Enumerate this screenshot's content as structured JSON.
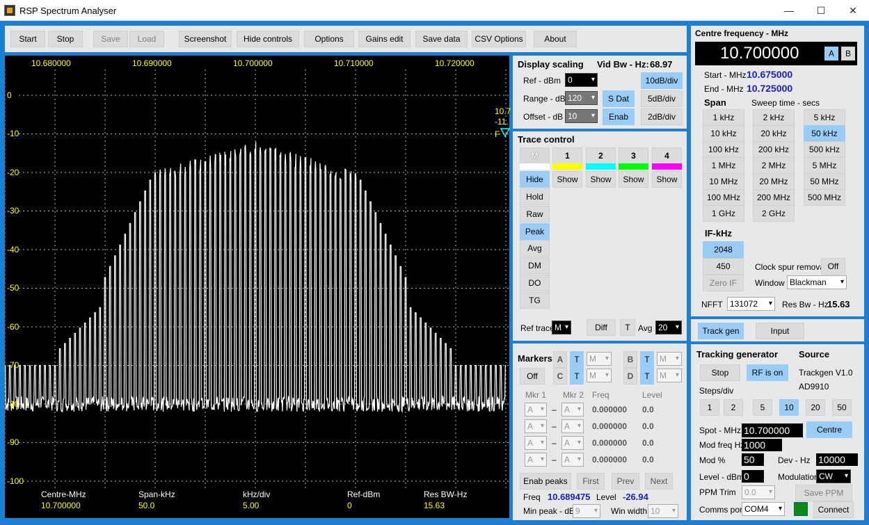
{
  "window": {
    "title": "RSP Spectrum Analyser",
    "min": "—",
    "max": "☐",
    "close": "✕"
  },
  "toolbar": {
    "start": "Start",
    "stop": "Stop",
    "save": "Save",
    "load": "Load",
    "screenshot": "Screenshot",
    "hide": "Hide controls",
    "options": "Options",
    "gains": "Gains edit",
    "savedata": "Save data",
    "csv": "CSV Options",
    "about": "About"
  },
  "plot": {
    "xticks": [
      "10.680000",
      "10.690000",
      "10.700000",
      "10.710000",
      "10.720000"
    ],
    "yticks": [
      "0",
      "-10",
      "-20",
      "-30",
      "-40",
      "-50",
      "-60",
      "-70",
      "-80",
      "-90",
      "-100"
    ],
    "marker_text1": "10.7",
    "marker_text2": "-11.",
    "marker_text3": "F",
    "footer": {
      "l1": "Centre-MHz",
      "v1": "10.700000",
      "l2": "Span-kHz",
      "v2": "50.0",
      "l3": "kHz/div",
      "v3": "5.00",
      "l4": "Ref-dBm",
      "v4": "0",
      "l5": "Res BW-Hz",
      "v5": "15.63"
    }
  },
  "chart_data": {
    "type": "line",
    "title": "",
    "xlabel": "",
    "ylabel": "",
    "xlim": [
      10.675,
      10.725
    ],
    "ylim": [
      -100,
      0
    ],
    "grid": true,
    "series": [
      {
        "values_note": "",
        "peaks_center": 10.7,
        "spacing": 0.0005
      }
    ]
  },
  "display": {
    "title": "Display scaling",
    "vidbw_label": "Vid Bw - Hz:",
    "vidbw": "68.97",
    "ref_label": "Ref - dBm",
    "ref": "0",
    "range_label": "Range - dB",
    "range": "120",
    "offset_label": "Offset - dB",
    "offset": "10",
    "b10": "10dB/div",
    "b5": "5dB/div",
    "b2": "2dB/div",
    "sdat": "S Dat",
    "enab": "Enab"
  },
  "trace": {
    "title": "Trace control",
    "tabs": [
      "M",
      "1",
      "2",
      "3",
      "4"
    ],
    "hide": "Hide",
    "show": "Show",
    "hold": "Hold",
    "raw": "Raw",
    "peak": "Peak",
    "avg": "Avg",
    "dm": "DM",
    "do": "DO",
    "tg": "TG",
    "reftrace_label": "Ref trace",
    "reftrace": "M",
    "diff": "Diff",
    "t": "T",
    "avg_label": "Avg",
    "avg_val": "20"
  },
  "markers": {
    "title": "Markers",
    "a": "A",
    "b": "B",
    "c": "C",
    "d": "D",
    "t": "T",
    "m": "M",
    "off": "Off",
    "mkr1": "Mkr 1",
    "mkr2": "Mkr 2",
    "freq_h": "Freq",
    "level_h": "Level",
    "freqs": [
      "0.000000",
      "0.000000",
      "0.000000",
      "0.000000"
    ],
    "levels": [
      "0.0",
      "0.0",
      "0.0",
      "0.0"
    ],
    "dash": "–",
    "enab_peaks": "Enab peaks",
    "first": "First",
    "prev": "Prev",
    "next": "Next",
    "freq_label": "Freq",
    "freq": "10.689475",
    "level_label": "Level",
    "level": "-26.94",
    "minpeak_label": "Min peak - dB",
    "minpeak": "9",
    "winwidth_label": "Win width",
    "winwidth": "10"
  },
  "centre": {
    "title": "Centre  frequency - MHz",
    "value": "10.700000",
    "a": "A",
    "b": "B",
    "start_label": "Start - MHz",
    "start": "10.675000",
    "end_label": "End - MHz",
    "end": "10.725000",
    "span": "Span",
    "sweep": "Sweep time - secs",
    "spans": [
      "1 kHz",
      "2 kHz",
      "5 kHz",
      "10 kHz",
      "20 kHz",
      "50 kHz",
      "100 kHz",
      "200 kHz",
      "500 kHz",
      "1 MHz",
      "2 MHz",
      "5 MHz",
      "10 MHz",
      "20 MHz",
      "50 MHz",
      "100 MHz",
      "200 MHz",
      "500 MHz",
      "1 GHz",
      "2 GHz"
    ],
    "if_label": "IF-kHz",
    "if1": "2048",
    "if2": "450",
    "zeroif": "Zero IF",
    "clock_label": "Clock spur removal",
    "clock": "Off",
    "window_label": "Window",
    "window": "Blackman",
    "nfft_label": "NFFT",
    "nfft": "131072",
    "resbw_label": "Res Bw - Hz",
    "resbw": "15.63"
  },
  "tabs": {
    "trackgen": "Track gen",
    "input": "Input"
  },
  "tracking": {
    "title": "Tracking generator",
    "source_label": "Source",
    "stop": "Stop",
    "rfon": "RF is on",
    "source1": "Trackgen V1.0",
    "source2": "AD9910",
    "steps_label": "Steps/div",
    "steps": [
      "1",
      "2",
      "5",
      "10",
      "20",
      "50"
    ],
    "spot_label": "Spot - MHz",
    "spot": "10.700000",
    "centre": "Centre",
    "modfreq_label": "Mod freq Hz",
    "modfreq": "1000",
    "modpct_label": "Mod %",
    "modpct": "50",
    "dev_label": "Dev - Hz",
    "dev": "10000",
    "level_label": "Level - dBm",
    "level": "0",
    "modulation_label": "Modulation",
    "modulation": "CW",
    "ppm_label": "PPM Trim",
    "ppm": "0.0",
    "saveppm": "Save PPM",
    "comms_label": "Comms port",
    "comms": "COM4",
    "connect": "Connect"
  },
  "colors": {
    "accent": "#99cdf7",
    "blue_text": "#1a20c8",
    "trace": "#ffffff",
    "axis": "#ffff00"
  }
}
